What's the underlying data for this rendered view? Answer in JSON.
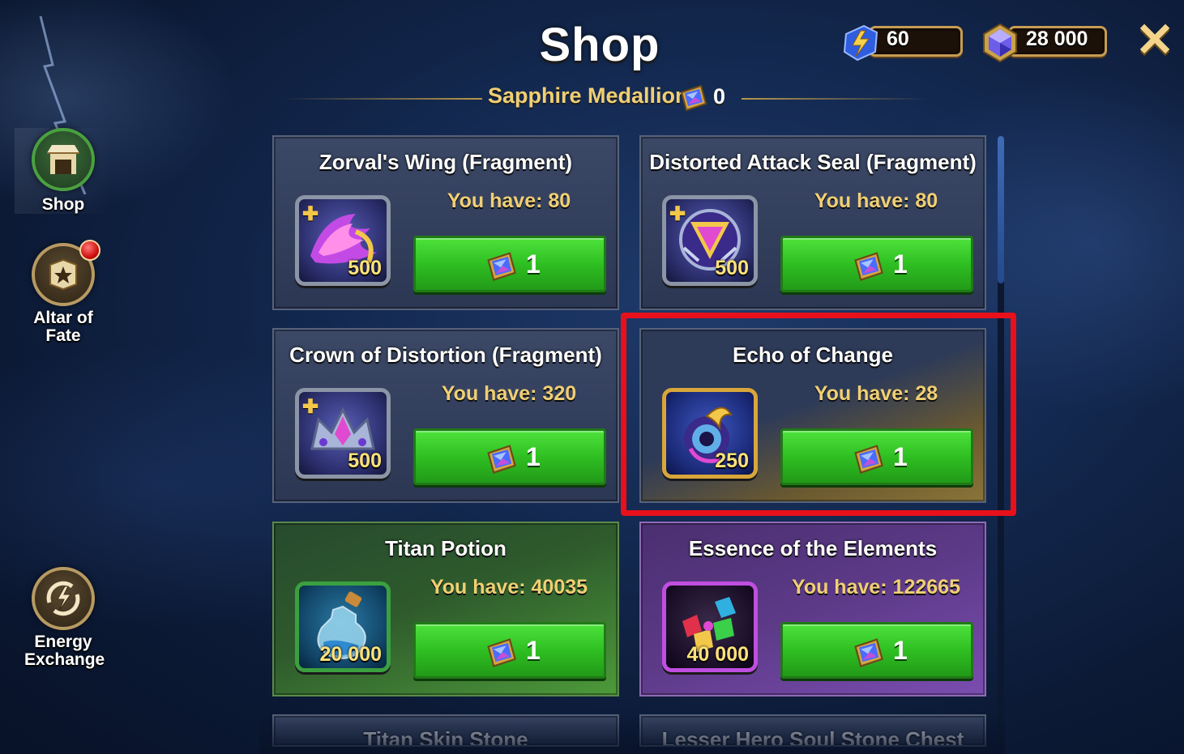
{
  "header": {
    "title": "Shop",
    "subtitle": "Sapphire Medallion",
    "medallion_count": "0",
    "energy": "60",
    "gems": "28 000",
    "close_icon": "close-icon"
  },
  "sidebar": {
    "items": [
      {
        "label": "Shop",
        "icon": "shop-icon"
      },
      {
        "label": "Altar of Fate",
        "icon": "star-icon"
      },
      {
        "label": "Energy Exchange",
        "icon": "energy-icon"
      }
    ]
  },
  "cards": [
    {
      "name": "Zorval's Wing (Fragment)",
      "have": "You have: 80",
      "qty": "500",
      "price": "1",
      "fragment": true
    },
    {
      "name": "Distorted Attack Seal (Fragment)",
      "have": "You have: 80",
      "qty": "500",
      "price": "1",
      "fragment": true
    },
    {
      "name": "Crown of Distortion (Fragment)",
      "have": "You have: 320",
      "qty": "500",
      "price": "1",
      "fragment": true
    },
    {
      "name": "Echo of Change",
      "have": "You have: 28",
      "qty": "250",
      "price": "1",
      "fragment": false
    },
    {
      "name": "Titan Potion",
      "have": "You have: 40035",
      "qty": "20 000",
      "price": "1",
      "fragment": false
    },
    {
      "name": "Essence of the Elements",
      "have": "You have: 122665",
      "qty": "40 000",
      "price": "1",
      "fragment": false
    },
    {
      "name": "Titan Skin Stone"
    },
    {
      "name": "Lesser Hero Soul Stone Chest"
    }
  ],
  "colors": {
    "accent_gold": "#f0cf74",
    "buy_green": "#2fbf22",
    "highlight_red": "#e8101a"
  }
}
